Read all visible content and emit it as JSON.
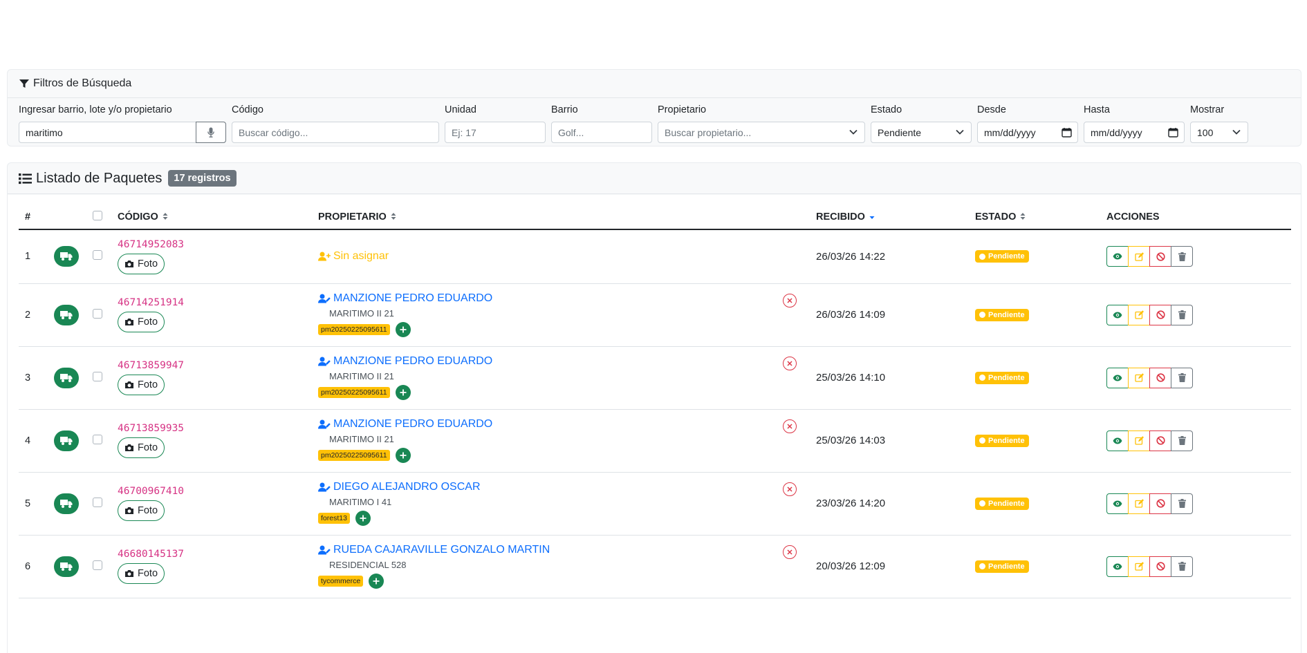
{
  "filters": {
    "title": "Filtros de Búsqueda",
    "search": {
      "label": "Ingresar barrio, lote y/o propietario",
      "value": "maritimo"
    },
    "codigo": {
      "label": "Código",
      "placeholder": "Buscar código..."
    },
    "unidad": {
      "label": "Unidad",
      "placeholder": "Ej: 17"
    },
    "barrio": {
      "label": "Barrio",
      "placeholder": "Golf..."
    },
    "propietario": {
      "label": "Propietario",
      "placeholder": "Buscar propietario..."
    },
    "estado": {
      "label": "Estado",
      "value": "Pendiente"
    },
    "desde": {
      "label": "Desde",
      "value": "mm/dd/yyyy"
    },
    "hasta": {
      "label": "Hasta",
      "value": "mm/dd/yyyy"
    },
    "mostrar": {
      "label": "Mostrar",
      "value": "100"
    }
  },
  "list": {
    "title": "Listado de Paquetes",
    "count": "17 registros",
    "columns": {
      "num": "#",
      "codigo": "CÓDIGO",
      "propietario": "PROPIETARIO",
      "recibido": "RECIBIDO",
      "estado": "ESTADO",
      "acciones": "ACCIONES"
    },
    "foto_label": "Foto",
    "rows": [
      {
        "num": "1",
        "code": "46714952083",
        "owner": "Sin asignar",
        "unassigned": true,
        "unit": "",
        "tag": "",
        "received": "26/03/26 14:22",
        "status": "Pendiente"
      },
      {
        "num": "2",
        "code": "46714251914",
        "owner": "MANZIONE PEDRO EDUARDO",
        "unassigned": false,
        "unit": "MARITIMO II 21",
        "tag": "pm20250225095611",
        "received": "26/03/26 14:09",
        "status": "Pendiente"
      },
      {
        "num": "3",
        "code": "46713859947",
        "owner": "MANZIONE PEDRO EDUARDO",
        "unassigned": false,
        "unit": "MARITIMO II 21",
        "tag": "pm20250225095611",
        "received": "25/03/26 14:10",
        "status": "Pendiente"
      },
      {
        "num": "4",
        "code": "46713859935",
        "owner": "MANZIONE PEDRO EDUARDO",
        "unassigned": false,
        "unit": "MARITIMO II 21",
        "tag": "pm20250225095611",
        "received": "25/03/26 14:03",
        "status": "Pendiente"
      },
      {
        "num": "5",
        "code": "46700967410",
        "owner": "DIEGO ALEJANDRO OSCAR",
        "unassigned": false,
        "unit": "MARITIMO I 41",
        "tag": "forest13",
        "received": "23/03/26 14:20",
        "status": "Pendiente"
      },
      {
        "num": "6",
        "code": "46680145137",
        "owner": "RUEDA CAJARAVILLE GONZALO MARTIN",
        "unassigned": false,
        "unit": "RESIDENCIAL 528",
        "tag": "tycommerce",
        "received": "20/03/26 12:09",
        "status": "Pendiente"
      }
    ]
  },
  "colors": {
    "success": "#198754",
    "warning": "#ffc107",
    "danger": "#dc3545",
    "primary": "#0d6efd",
    "code": "#d63384",
    "secondary": "#6c757d"
  },
  "icons": {
    "filter": "filter-icon",
    "list": "list-icon",
    "mic": "microphone-icon",
    "truck": "truck-icon",
    "camera": "camera-icon",
    "user_edit": "user-pen-icon",
    "user_plus": "user-plus-icon",
    "add": "plus-icon",
    "remove": "x-circle-icon",
    "view": "eye-icon",
    "edit": "edit-icon",
    "cancel": "ban-icon",
    "delete": "trash-icon",
    "status": "clock-icon"
  }
}
